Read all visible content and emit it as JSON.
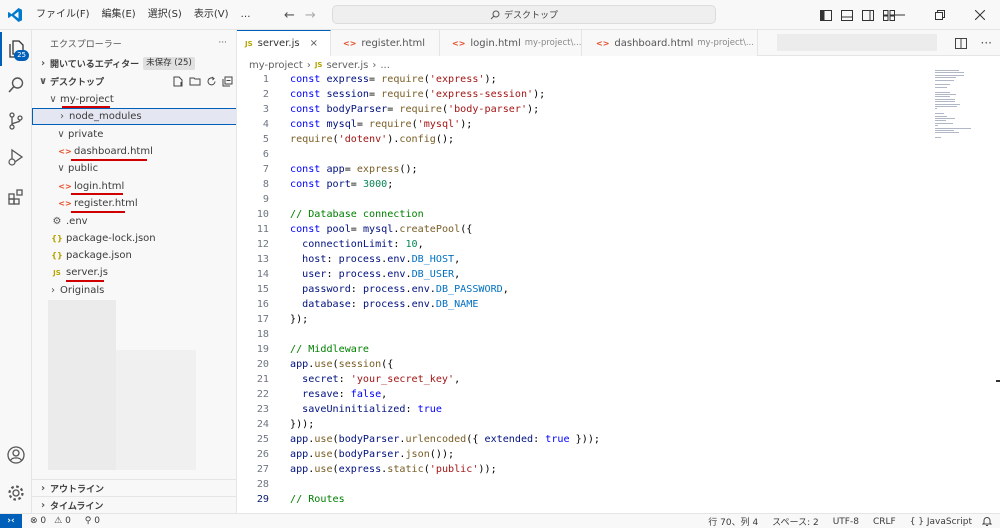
{
  "titlebar": {
    "menu": [
      "ファイル(F)",
      "編集(E)",
      "選択(S)",
      "表示(V)",
      "…"
    ],
    "back_arrow": "←",
    "forward_arrow": "→",
    "command_center": "デスクトップ",
    "accent": "#005fb8"
  },
  "activity": {
    "explorer_badge": "25"
  },
  "sidebar": {
    "title": "エクスプローラー",
    "more": "···",
    "open_editors_label": "開いているエディター",
    "unsaved_badge": "未保存 (25)",
    "workspace_label": "デスクトップ",
    "outline_label": "アウトライン",
    "timeline_label": "タイムライン",
    "tree": [
      {
        "label": "my-project",
        "chev": "∨",
        "icon": ""
      },
      {
        "label": "node_modules",
        "chev": "›",
        "icon": ""
      },
      {
        "label": "private",
        "chev": "∨",
        "icon": ""
      },
      {
        "label": "dashboard.html",
        "chev": "",
        "icon": "<>"
      },
      {
        "label": "public",
        "chev": "∨",
        "icon": ""
      },
      {
        "label": "login.html",
        "chev": "",
        "icon": "<>"
      },
      {
        "label": "register.html",
        "chev": "",
        "icon": "<>"
      },
      {
        "label": ".env",
        "chev": "",
        "icon": "⚙"
      },
      {
        "label": "package-lock.json",
        "chev": "",
        "icon": "{}"
      },
      {
        "label": "package.json",
        "chev": "",
        "icon": "{}"
      },
      {
        "label": "server.js",
        "chev": "",
        "icon": "JS"
      },
      {
        "label": "Originals",
        "chev": "›",
        "icon": ""
      }
    ]
  },
  "editor": {
    "tabs": [
      {
        "icon": "JS",
        "label": "server.js",
        "desc": "",
        "close": "×"
      },
      {
        "icon": "<>",
        "label": "register.html",
        "desc": "",
        "close": ""
      },
      {
        "icon": "<>",
        "label": "login.html",
        "desc": "my-project\\...",
        "close": ""
      },
      {
        "icon": "<>",
        "label": "dashboard.html",
        "desc": "my-project\\...",
        "close": ""
      }
    ],
    "breadcrumb": {
      "folder": "my-project",
      "sep1": "›",
      "icon": "JS",
      "file": "server.js",
      "sep2": "›",
      "tail": "..."
    },
    "current_line": 29,
    "lines": [
      {
        "n": "1",
        "t": [
          [
            "kw",
            "const "
          ],
          [
            "vr",
            "express"
          ],
          [
            "",
            "= "
          ],
          [
            "fn",
            "require"
          ],
          [
            "",
            "("
          ],
          [
            "str",
            "'express'"
          ],
          [
            "",
            ");"
          ]
        ]
      },
      {
        "n": "2",
        "t": [
          [
            "kw",
            "const "
          ],
          [
            "vr",
            "session"
          ],
          [
            "",
            "= "
          ],
          [
            "fn",
            "require"
          ],
          [
            "",
            "("
          ],
          [
            "str",
            "'express-session'"
          ],
          [
            "",
            ");"
          ]
        ]
      },
      {
        "n": "3",
        "t": [
          [
            "kw",
            "const "
          ],
          [
            "vr",
            "bodyParser"
          ],
          [
            "",
            "= "
          ],
          [
            "fn",
            "require"
          ],
          [
            "",
            "("
          ],
          [
            "str",
            "'body-parser'"
          ],
          [
            "",
            ");"
          ]
        ]
      },
      {
        "n": "4",
        "t": [
          [
            "kw",
            "const "
          ],
          [
            "vr",
            "mysql"
          ],
          [
            "",
            "= "
          ],
          [
            "fn",
            "require"
          ],
          [
            "",
            "("
          ],
          [
            "str",
            "'mysql'"
          ],
          [
            "",
            ");"
          ]
        ]
      },
      {
        "n": "5",
        "t": [
          [
            "fn",
            "require"
          ],
          [
            "",
            "("
          ],
          [
            "str",
            "'dotenv'"
          ],
          [
            "",
            ")."
          ],
          [
            "fn",
            "config"
          ],
          [
            "",
            "();"
          ]
        ]
      },
      {
        "n": "6",
        "t": []
      },
      {
        "n": "7",
        "t": [
          [
            "kw",
            "const "
          ],
          [
            "vr",
            "app"
          ],
          [
            "",
            "= "
          ],
          [
            "fn",
            "express"
          ],
          [
            "",
            "();"
          ]
        ]
      },
      {
        "n": "8",
        "t": [
          [
            "kw",
            "const "
          ],
          [
            "vr",
            "port"
          ],
          [
            "",
            "= "
          ],
          [
            "num",
            "3000"
          ],
          [
            "",
            ";"
          ]
        ]
      },
      {
        "n": "9",
        "t": []
      },
      {
        "n": "10",
        "t": [
          [
            "cm",
            "// Database connection"
          ]
        ]
      },
      {
        "n": "11",
        "t": [
          [
            "kw",
            "const "
          ],
          [
            "vr",
            "pool"
          ],
          [
            "",
            "= "
          ],
          [
            "vr",
            "mysql"
          ],
          [
            "",
            "."
          ],
          [
            "fn",
            "createPool"
          ],
          [
            "",
            "({"
          ]
        ]
      },
      {
        "n": "12",
        "t": [
          [
            "",
            "  "
          ],
          [
            "vr",
            "connectionLimit"
          ],
          [
            "",
            ": "
          ],
          [
            "num",
            "10"
          ],
          [
            "",
            ","
          ]
        ]
      },
      {
        "n": "13",
        "t": [
          [
            "",
            "  "
          ],
          [
            "vr",
            "host"
          ],
          [
            "",
            ": "
          ],
          [
            "vr",
            "process"
          ],
          [
            "",
            "."
          ],
          [
            "vr",
            "env"
          ],
          [
            "",
            "."
          ],
          [
            "cst",
            "DB_HOST"
          ],
          [
            "",
            ","
          ]
        ]
      },
      {
        "n": "14",
        "t": [
          [
            "",
            "  "
          ],
          [
            "vr",
            "user"
          ],
          [
            "",
            ": "
          ],
          [
            "vr",
            "process"
          ],
          [
            "",
            "."
          ],
          [
            "vr",
            "env"
          ],
          [
            "",
            "."
          ],
          [
            "cst",
            "DB_USER"
          ],
          [
            "",
            ","
          ]
        ]
      },
      {
        "n": "15",
        "t": [
          [
            "",
            "  "
          ],
          [
            "vr",
            "password"
          ],
          [
            "",
            ": "
          ],
          [
            "vr",
            "process"
          ],
          [
            "",
            "."
          ],
          [
            "vr",
            "env"
          ],
          [
            "",
            "."
          ],
          [
            "cst",
            "DB_PASSWORD"
          ],
          [
            "",
            ","
          ]
        ]
      },
      {
        "n": "16",
        "t": [
          [
            "",
            "  "
          ],
          [
            "vr",
            "database"
          ],
          [
            "",
            ": "
          ],
          [
            "vr",
            "process"
          ],
          [
            "",
            "."
          ],
          [
            "vr",
            "env"
          ],
          [
            "",
            "."
          ],
          [
            "cst",
            "DB_NAME"
          ]
        ]
      },
      {
        "n": "17",
        "t": [
          [
            "",
            "});"
          ]
        ]
      },
      {
        "n": "18",
        "t": []
      },
      {
        "n": "19",
        "t": [
          [
            "cm",
            "// Middleware"
          ]
        ]
      },
      {
        "n": "20",
        "t": [
          [
            "vr",
            "app"
          ],
          [
            "",
            "."
          ],
          [
            "fn",
            "use"
          ],
          [
            "",
            "("
          ],
          [
            "fn",
            "session"
          ],
          [
            "",
            "({"
          ]
        ]
      },
      {
        "n": "21",
        "t": [
          [
            "",
            "  "
          ],
          [
            "vr",
            "secret"
          ],
          [
            "",
            ": "
          ],
          [
            "str",
            "'your_secret_key'"
          ],
          [
            "",
            ","
          ]
        ]
      },
      {
        "n": "22",
        "t": [
          [
            "",
            "  "
          ],
          [
            "vr",
            "resave"
          ],
          [
            "",
            ": "
          ],
          [
            "kw",
            "false"
          ],
          [
            "",
            ","
          ]
        ]
      },
      {
        "n": "23",
        "t": [
          [
            "",
            "  "
          ],
          [
            "vr",
            "saveUninitialized"
          ],
          [
            "",
            ": "
          ],
          [
            "kw",
            "true"
          ]
        ]
      },
      {
        "n": "24",
        "t": [
          [
            "",
            "}));"
          ]
        ]
      },
      {
        "n": "25",
        "t": [
          [
            "vr",
            "app"
          ],
          [
            "",
            "."
          ],
          [
            "fn",
            "use"
          ],
          [
            "",
            "("
          ],
          [
            "vr",
            "bodyParser"
          ],
          [
            "",
            "."
          ],
          [
            "fn",
            "urlencoded"
          ],
          [
            "",
            "({ "
          ],
          [
            "vr",
            "extended"
          ],
          [
            "",
            ": "
          ],
          [
            "kw",
            "true"
          ],
          [
            "",
            " }));"
          ]
        ]
      },
      {
        "n": "26",
        "t": [
          [
            "vr",
            "app"
          ],
          [
            "",
            "."
          ],
          [
            "fn",
            "use"
          ],
          [
            "",
            "("
          ],
          [
            "vr",
            "bodyParser"
          ],
          [
            "",
            "."
          ],
          [
            "fn",
            "json"
          ],
          [
            "",
            "());"
          ]
        ]
      },
      {
        "n": "27",
        "t": [
          [
            "vr",
            "app"
          ],
          [
            "",
            "."
          ],
          [
            "fn",
            "use"
          ],
          [
            "",
            "("
          ],
          [
            "vr",
            "express"
          ],
          [
            "",
            "."
          ],
          [
            "fn",
            "static"
          ],
          [
            "",
            "("
          ],
          [
            "str",
            "'public'"
          ],
          [
            "",
            "));"
          ]
        ]
      },
      {
        "n": "28",
        "t": []
      },
      {
        "n": "29",
        "t": [
          [
            "cm",
            "// Routes"
          ]
        ]
      }
    ]
  },
  "status": {
    "errors": "⊗ 0",
    "warnings": "⚠ 0",
    "ports": "⚲ 0",
    "position": "行 70、列 4",
    "spaces": "スペース: 2",
    "encoding": "UTF-8",
    "eol": "CRLF",
    "language": "{ } JavaScript"
  }
}
